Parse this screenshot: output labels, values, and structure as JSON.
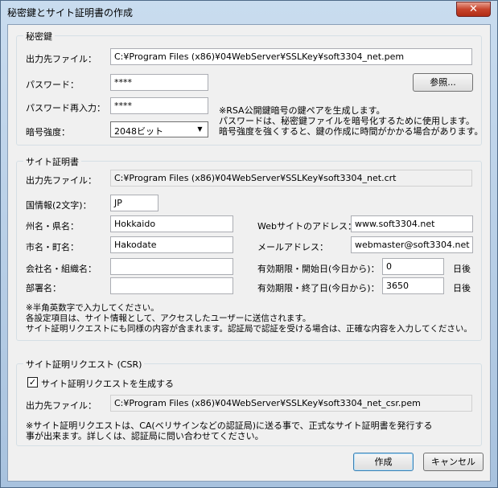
{
  "window": {
    "title": "秘密鍵とサイト証明書の作成",
    "close_glyph": "✕"
  },
  "private_key": {
    "legend": "秘密鍵",
    "output_label": "出力先ファイル：",
    "output_value": "C:¥Program Files (x86)¥04WebServer¥SSLKey¥soft3304_net.pem",
    "password_label": "パスワード：",
    "password_value": "****",
    "password_confirm_label": "パスワード再入力：",
    "password_confirm_value": "****",
    "strength_label": "暗号強度：",
    "strength_value": "2048ビット",
    "browse_button": "参照...",
    "note": "※RSA公開鍵暗号の鍵ペアを生成します。\nパスワードは、秘密鍵ファイルを暗号化するために使用します。\n暗号強度を強くすると、鍵の作成に時間がかかる場合があります。"
  },
  "certificate": {
    "legend": "サイト証明書",
    "output_label": "出力先ファイル：",
    "output_value": "C:¥Program Files (x86)¥04WebServer¥SSLKey¥soft3304_net.crt",
    "country_label": "国情報(2文字)：",
    "country_value": "JP",
    "state_label": "州名・県名：",
    "state_value": "Hokkaido",
    "city_label": "市名・町名：",
    "city_value": "Hakodate",
    "org_label": "会社名・組織名：",
    "org_value": "",
    "dept_label": "部署名：",
    "dept_value": "",
    "website_label": "Webサイトのアドレス：",
    "website_value": "www.soft3304.net",
    "email_label": "メールアドレス：",
    "email_value": "webmaster@soft3304.net",
    "start_label": "有効期限・開始日(今日から)：",
    "start_value": "0",
    "end_label": "有効期限・終了日(今日から)：",
    "end_value": "3650",
    "days_unit": "日後",
    "note": "※半角英数字で入力してください。\n各設定項目は、サイト情報として、アクセスしたユーザーに送信されます。\nサイト証明リクエストにも同様の内容が含まれます。認証局で認証を受ける場合は、正確な内容を入力してください。"
  },
  "csr": {
    "legend": "サイト証明リクエスト (CSR)",
    "checkbox_label": "サイト証明リクエストを生成する",
    "checkbox_mark": "✓",
    "output_label": "出力先ファイル：",
    "output_value": "C:¥Program Files (x86)¥04WebServer¥SSLKey¥soft3304_net_csr.pem",
    "note": "※サイト証明リクエストは、CA(ベリサインなどの認証局)に送る事で、正式なサイト証明書を発行する\n事が出来ます。詳しくは、認証局に問い合わせてください。"
  },
  "footer": {
    "create_button": "作成",
    "cancel_button": "キャンセル"
  }
}
